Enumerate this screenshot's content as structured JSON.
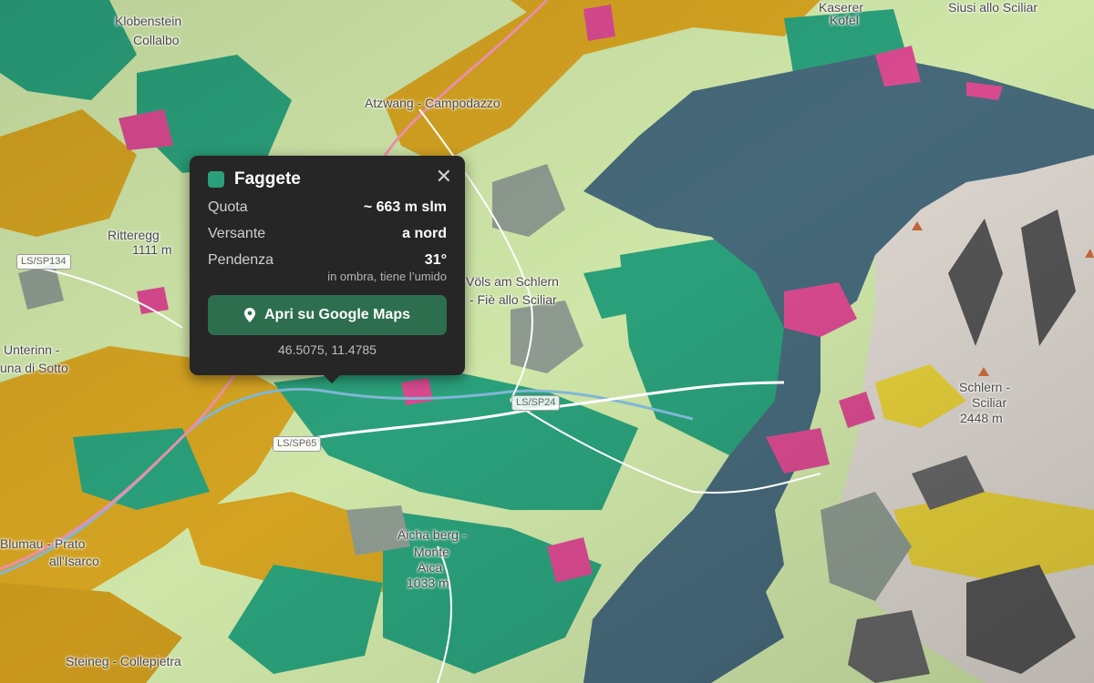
{
  "map": {
    "colors": {
      "meadow": "#cfe6a8",
      "beech": "#2aa07a",
      "larch": "#d4a321",
      "dark_forest": "#46697a",
      "rock": "#dcd6cf",
      "scree": "#e6cf3a",
      "pink": "#d94a8f",
      "grey": "#8e9a8f"
    },
    "place_labels": [
      "Klobenstein",
      "Collalbo",
      "Kaserer",
      "Kofel",
      "Siusi allo Sciliar",
      "Atzwang - Campodazzo",
      "Ritteregg",
      "1111 m",
      "Völs am Schlern",
      "- Fiè allo Sciliar",
      "Unterinn -",
      "una di Sotto",
      "Schlern - ",
      "Sciliar",
      "2448 m",
      "Blumau - Prato",
      "all'Isarco",
      "Aicha berg -",
      "Monte",
      "Aica",
      "1033 m",
      "Steineg - Collepietra"
    ],
    "road_shields": [
      "LS/SP134",
      "LS/SP24",
      "LS/SP65"
    ]
  },
  "popup": {
    "title": "Faggete",
    "swatch_color": "#2aa07a",
    "close_icon": "close-icon",
    "rows": [
      {
        "label": "Quota",
        "value": "~ 663 m slm"
      },
      {
        "label": "Versante",
        "value": "a nord"
      },
      {
        "label": "Pendenza",
        "value": "31°"
      }
    ],
    "note": "in ombra, tiene l’umido",
    "button_label": "Apri su Google Maps",
    "button_icon": "map-pin-icon",
    "button_color": "#2d6e4e",
    "coords": "46.5075, 11.4785"
  }
}
